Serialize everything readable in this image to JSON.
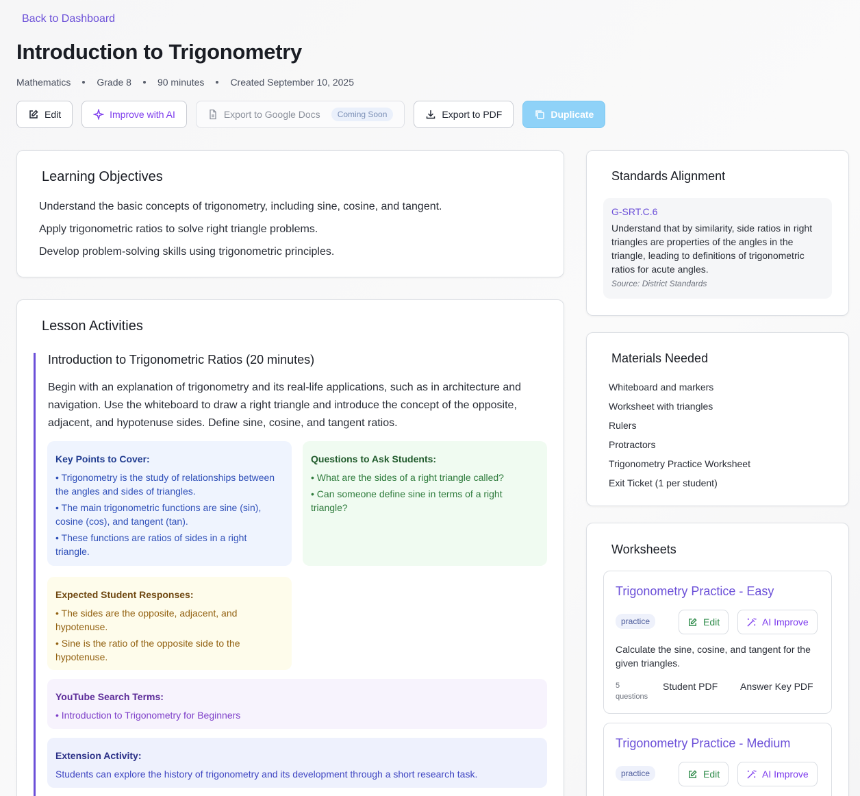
{
  "nav": {
    "back_label": "Back to Dashboard"
  },
  "lesson": {
    "title": "Introduction to Trigonometry",
    "meta": {
      "subject": "Mathematics",
      "grade": "Grade 8",
      "duration": "90 minutes",
      "created": "Created September 10, 2025"
    }
  },
  "toolbar": {
    "edit_label": "Edit",
    "improve_label": "Improve with AI",
    "export_docs_label": "Export to Google Docs",
    "coming_soon_label": "Coming Soon",
    "export_pdf_label": "Export to PDF",
    "duplicate_label": "Duplicate"
  },
  "objectives": {
    "title": "Learning Objectives",
    "items": [
      "Understand the basic concepts of trigonometry, including sine, cosine, and tangent.",
      "Apply trigonometric ratios to solve right triangle problems.",
      "Develop problem-solving skills using trigonometric principles."
    ]
  },
  "activities": {
    "title": "Lesson Activities",
    "items": [
      {
        "title": "Introduction to Trigonometric Ratios (20 minutes)",
        "description": "Begin with an explanation of trigonometry and its real-life applications, such as in architecture and navigation. Use the whiteboard to draw a right triangle and introduce the concept of the opposite, adjacent, and hypotenuse sides. Define sine, cosine, and tangent ratios.",
        "key_points": {
          "title": "Key Points to Cover:",
          "items": [
            "Trigonometry is the study of relationships between the angles and sides of triangles.",
            "The main trigonometric functions are sine (sin), cosine (cos), and tangent (tan).",
            "These functions are ratios of sides in a right triangle."
          ]
        },
        "questions": {
          "title": "Questions to Ask Students:",
          "items": [
            "What are the sides of a right triangle called?",
            "Can someone define sine in terms of a right triangle?"
          ]
        },
        "responses": {
          "title": "Expected Student Responses:",
          "items": [
            "The sides are the opposite, adjacent, and hypotenuse.",
            "Sine is the ratio of the opposite side to the hypotenuse."
          ]
        },
        "youtube": {
          "title": "YouTube Search Terms:",
          "items": [
            "Introduction to Trigonometry for Beginners"
          ]
        },
        "extension": {
          "title": "Extension Activity:",
          "text": "Students can explore the history of trigonometry and its development through a short research task."
        }
      }
    ]
  },
  "standards": {
    "title": "Standards Alignment",
    "items": [
      {
        "code": "G-SRT.C.6",
        "text": "Understand that by similarity, side ratios in right triangles are properties of the angles in the triangle, leading to definitions of trigonometric ratios for acute angles.",
        "source": "Source: District Standards"
      }
    ]
  },
  "materials": {
    "title": "Materials Needed",
    "items": [
      "Whiteboard and markers",
      "Worksheet with triangles",
      "Rulers",
      "Protractors",
      "Trigonometry Practice Worksheet",
      "Exit Ticket (1 per student)"
    ]
  },
  "worksheets": {
    "title": "Worksheets",
    "edit_label": "Edit",
    "ai_label": "AI Improve",
    "student_pdf_label": "Student PDF",
    "answer_pdf_label": "Answer Key PDF",
    "items": [
      {
        "title": "Trigonometry Practice - Easy",
        "tag": "practice",
        "description": "Calculate the sine, cosine, and tangent for the given triangles.",
        "count": "5",
        "count_unit": "questions"
      },
      {
        "title": "Trigonometry Practice - Medium",
        "tag": "practice"
      }
    ]
  },
  "colors": {
    "accent": "#6b4fd8",
    "primary_button": "#8fd2f8",
    "ai": "#7c3aed",
    "edit_green": "#2e8b4a"
  }
}
